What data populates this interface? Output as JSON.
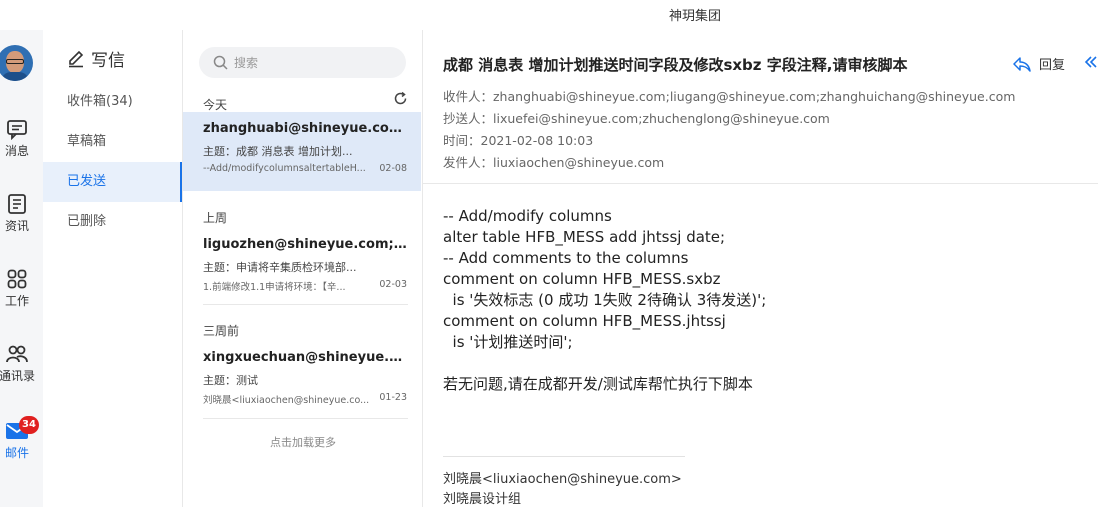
{
  "window": {
    "title": "神玥集团"
  },
  "rail": {
    "items": [
      {
        "label": "消息"
      },
      {
        "label": "资讯"
      },
      {
        "label": "工作"
      },
      {
        "label": "通讯录"
      },
      {
        "label": "邮件",
        "badge": "34"
      }
    ]
  },
  "folders": {
    "compose_label": "写信",
    "items": [
      {
        "label": "收件箱(34)"
      },
      {
        "label": "草稿箱"
      },
      {
        "label": "已发送"
      },
      {
        "label": "已删除"
      }
    ],
    "active_index": 2
  },
  "mail_list": {
    "search_placeholder": "搜索",
    "groups": [
      {
        "label": "今天"
      },
      {
        "label": "上周"
      },
      {
        "label": "三周前"
      }
    ],
    "items": [
      {
        "from": "zhanghuabi@shineyue.com;...",
        "subject": "主题：成都 消息表 增加计划...",
        "preview": "--Add/modifycolumnsaltertableH...",
        "date": "02-08"
      },
      {
        "from": "liguozhen@shineyue.com;w...",
        "subject": "主题：申请将辛集质检环境部...",
        "preview": "1.前端修改1.1申请将环境：【辛...",
        "date": "02-03"
      },
      {
        "from": "xingxuechuan@shineyue.com",
        "subject": "主题：测试",
        "preview": "刘晓晨<liuxiaochen@shineyue.co...",
        "date": "01-23"
      }
    ],
    "load_more": "点击加载更多"
  },
  "reader": {
    "subject": "成都 消息表 增加计划推送时间字段及修改sxbz 字段注释,请审核脚本",
    "reply_label": "回复",
    "to": "收件人：zhanghuabi@shineyue.com;liugang@shineyue.com;zhanghuichang@shineyue.com",
    "cc": "抄送人：lixuefei@shineyue.com;zhuchenglong@shineyue.com",
    "time": "时间：2021-02-08 10:03",
    "sender": "发件人：liuxiaochen@shineyue.com",
    "body": "-- Add/modify columns\nalter table HFB_MESS add jhtssj date;\n-- Add comments to the columns\ncomment on column HFB_MESS.sxbz\n  is '失效标志 (0 成功 1失败 2待确认 3待发送)';\ncomment on column HFB_MESS.jhtssj\n  is '计划推送时间';\n\n若无问题,请在成都开发/测试库帮忙执行下脚本",
    "signature": [
      "刘晓晨<liuxiaochen@shineyue.com>",
      "刘晓晨设计组"
    ]
  },
  "colors": {
    "accent": "#1a73e8",
    "badge": "#e02020",
    "selected_row": "#dfe9f8"
  }
}
